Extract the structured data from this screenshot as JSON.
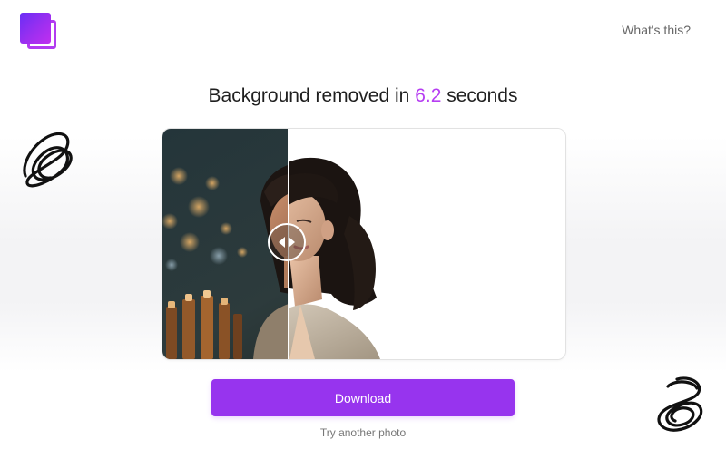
{
  "header": {
    "logo_icon": "layered-squares-logo-icon",
    "whats_this_link": "What's this?"
  },
  "headline": {
    "prefix": "Background removed in",
    "seconds_value": "6.2",
    "suffix": "seconds"
  },
  "compare": {
    "original_label": "original-photo",
    "result_label": "background-removed-photo",
    "handle_icon": "left-right-arrows-icon"
  },
  "actions": {
    "download_label": "Download",
    "try_another_label": "Try another photo"
  },
  "colors": {
    "accent": "#b63ef2",
    "button": "#9734ee",
    "logo_start": "#6a2ef5",
    "logo_end": "#c02ff0"
  },
  "decor": {
    "left_scribble": "scribble-doodle-icon",
    "right_scribble": "spiral-doodle-icon"
  }
}
